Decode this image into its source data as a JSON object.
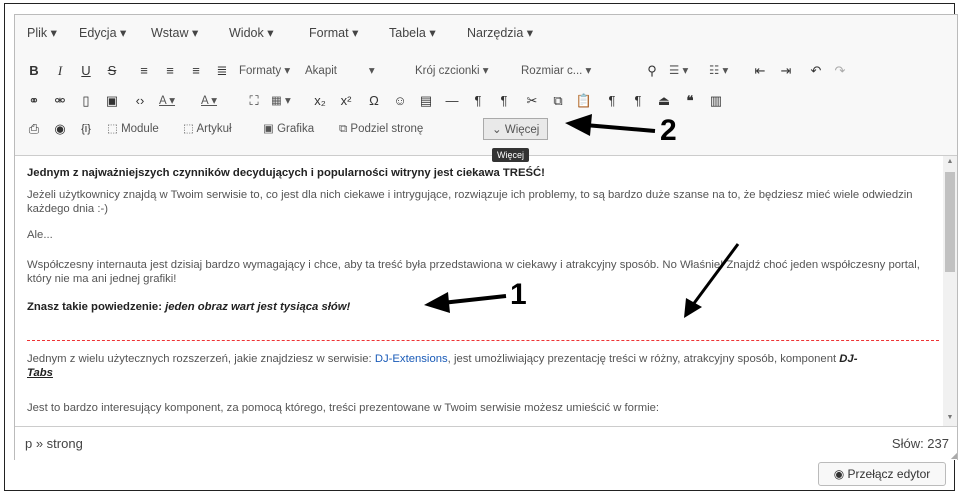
{
  "menubar": [
    "Plik",
    "Edycja",
    "Wstaw",
    "Widok",
    "Format",
    "Tabela",
    "Narzędzia"
  ],
  "toolbar": {
    "row1": {
      "bold": "B",
      "italic": "I",
      "underline": "U",
      "strike": "S",
      "formats": "Formaty",
      "paragraph": "Akapit",
      "font_family": "Krój czcionki",
      "font_size": "Rozmiar c..."
    },
    "row3": {
      "module": "Module",
      "article": "Artykuł",
      "image": "Grafika",
      "pagebreak": "Podziel stronę",
      "more": "Więcej"
    },
    "tooltip": "Więcej"
  },
  "content": {
    "p1": "Jednym z najważniejszych czynników decydujących i popularności witryny jest ciekawa TREŚĆ!",
    "p2": "Jeżeli użytkownicy znajdą w Twoim serwisie to, co jest dla nich ciekawe i intrygujące, rozwiązuje ich problemy, to są bardzo duże szanse na to, że będziesz mieć wiele odwiedzin każdego dnia :-)",
    "p3": "Ale...",
    "p4": "Współczesny internauta jest dzisiaj bardzo wymagający i chce, aby ta treść była przedstawiona w ciekawy i atrakcyjny sposób. No Właśnie! Znajdź choć jeden współczesny portal, który nie ma ani jednej grafiki!",
    "p5_lead": "Znasz takie powiedzenie: ",
    "p5_quote": "jeden obraz wart jest tysiąca słów!",
    "p6_a": "Jednym z wielu użytecznych rozszerzeń, jakie znajdziesz w serwisie: ",
    "p6_link": "DJ-Extensions",
    "p6_b": ", jest umożliwiający prezentację treści w różny, atrakcyjny sposób, komponent ",
    "p6_comp": "DJ-",
    "p6_comp2": "Tabs",
    "p7": "Jest to bardzo interesujący komponent, za pomocą którego, treści prezentowane w Twoim serwisie możesz umieścić w formie:"
  },
  "statusbar": {
    "path": "p » strong",
    "words": "Słów: 237"
  },
  "switch_editor": "Przełącz edytor",
  "annotations": {
    "one": "1",
    "two": "2"
  }
}
